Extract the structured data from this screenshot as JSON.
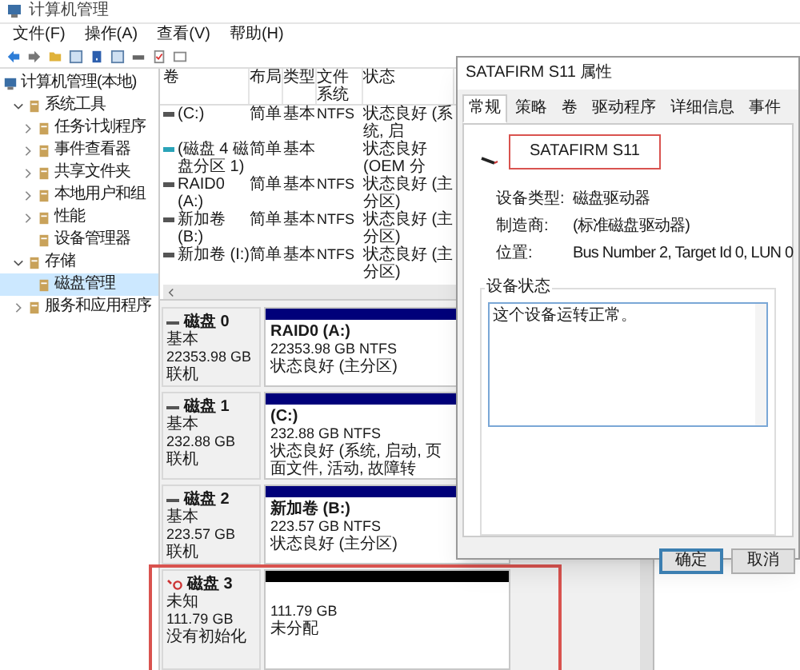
{
  "window": {
    "title": "计算机管理"
  },
  "menu": [
    "文件(F)",
    "操作(A)",
    "查看(V)",
    "帮助(H)"
  ],
  "tree": [
    {
      "label": "计算机管理(本地)",
      "selected": false,
      "children": [
        {
          "label": "系统工具",
          "expanded": true,
          "selected": false,
          "children": [
            {
              "label": "任务计划程序",
              "expanded": false,
              "selected": false
            },
            {
              "label": "事件查看器",
              "expanded": false,
              "selected": false
            },
            {
              "label": "共享文件夹",
              "expanded": false,
              "selected": false
            },
            {
              "label": "本地用户和组",
              "expanded": false,
              "selected": false
            },
            {
              "label": "性能",
              "expanded": false,
              "selected": false
            },
            {
              "label": "设备管理器",
              "selected": false
            }
          ]
        },
        {
          "label": "存储",
          "expanded": true,
          "selected": false,
          "children": [
            {
              "label": "磁盘管理",
              "selected": true
            }
          ]
        },
        {
          "label": "服务和应用程序",
          "expanded": false,
          "selected": false
        }
      ]
    }
  ],
  "volumes": {
    "columns": [
      "卷",
      "布局",
      "类型",
      "文件系统",
      "状态"
    ],
    "rows": [
      {
        "volume": "(C:)",
        "layout": "简单",
        "type": "基本",
        "file_system": "NTFS",
        "status": "状态良好 (系统, 启",
        "color": "#555555"
      },
      {
        "volume": "(磁盘 4 磁盘分区 1)",
        "layout": "简单",
        "type": "基本",
        "status": "状态良好 (OEM 分",
        "color": "#2aa3b8"
      },
      {
        "volume": "RAID0 (A:)",
        "layout": "简单",
        "type": "基本",
        "file_system": "NTFS",
        "status": "状态良好 (主分区)",
        "color": "#555555"
      },
      {
        "volume": "新加卷 (B:)",
        "layout": "简单",
        "type": "基本",
        "file_system": "NTFS",
        "status": "状态良好 (主分区)",
        "color": "#555555"
      },
      {
        "volume": "新加卷 (I:)",
        "layout": "简单",
        "type": "基本",
        "file_system": "NTFS",
        "status": "状态良好 (主分区)",
        "color": "#555555"
      }
    ]
  },
  "disks": [
    {
      "name": "磁盘 0",
      "type": "基本",
      "size": "22353.98 GB",
      "status": "联机",
      "kind": "online",
      "highlighted": false,
      "partition": {
        "kind": "primary",
        "title": "RAID0  (A:)",
        "size": "22353.98 GB NTFS",
        "status": "状态良好 (主分区)"
      }
    },
    {
      "name": "磁盘 1",
      "type": "基本",
      "size": "232.88 GB",
      "status": "联机",
      "kind": "online",
      "highlighted": false,
      "partition": {
        "kind": "primary",
        "title": "(C:)",
        "size": "232.88 GB NTFS",
        "status": "状态良好 (系统, 启动, 页面文件, 活动, 故障转"
      }
    },
    {
      "name": "磁盘 2",
      "type": "基本",
      "size": "223.57 GB",
      "status": "联机",
      "kind": "online",
      "highlighted": false,
      "partition": {
        "kind": "primary",
        "title": "新加卷  (B:)",
        "size": "223.57 GB NTFS",
        "status": "状态良好 (主分区)"
      }
    },
    {
      "name": "磁盘 3",
      "type": "未知",
      "size": "111.79 GB",
      "status": "没有初始化",
      "kind": "uninitialized",
      "highlighted": true,
      "partition": {
        "kind": "unallocated",
        "size": "111.79 GB",
        "status": "未分配"
      }
    }
  ],
  "dialog": {
    "title": "SATAFIRM   S11 属性",
    "tabs": [
      {
        "label": "常规",
        "selected": true
      },
      {
        "label": "策略",
        "selected": false
      },
      {
        "label": "卷",
        "selected": false
      },
      {
        "label": "驱动程序",
        "selected": false
      },
      {
        "label": "详细信息",
        "selected": false
      },
      {
        "label": "事件",
        "selected": false
      }
    ],
    "device": {
      "name": "SATAFIRM   S11",
      "highlighted": true
    },
    "properties": [
      {
        "label": "设备类型:",
        "value": "磁盘驱动器"
      },
      {
        "label": "制造商:",
        "value": "(标准磁盘驱动器)"
      },
      {
        "label": "位置:",
        "value": "Bus Number 2, Target Id 0, LUN 0"
      }
    ],
    "status_group": {
      "title": "设备状态",
      "text": "这个设备运转正常。"
    },
    "buttons": [
      {
        "label": "确定",
        "default": true
      },
      {
        "label": "取消",
        "default": false
      }
    ]
  }
}
